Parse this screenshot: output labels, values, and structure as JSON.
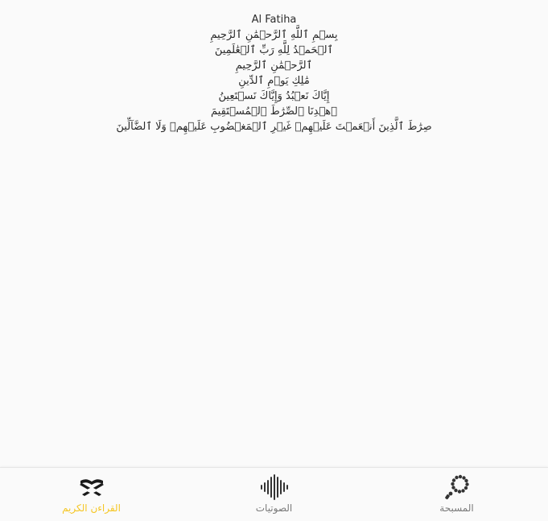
{
  "surah": {
    "title": "Al Fatiha",
    "ayahs": [
      "بِسۡمِ ٱللَّهِ ٱلرَّحۡمَٰنِ ٱلرَّحِيمِ",
      "ٱلۡحَمۡدُ لِلَّهِ رَبِّ ٱلۡعَٰلَمِينَ",
      "ٱلرَّحۡمَٰنِ ٱلرَّحِيمِ",
      "مَٰلِكِ يَوۡمِ ٱلدِّينِ",
      "إِيَّاكَ نَعۡبُدُ وَإِيَّاكَ نَسۡتَعِينُ",
      "ٱهۡدِنَا ٱلصِّرَٰطَ ٱلۡمُسۡتَقِيمَ",
      "صِرَٰطَ ٱلَّذِينَ أَنۡعَمۡتَ عَلَيۡهِمۡ غَيۡرِ ٱلۡمَغۡضُوبِ عَلَيۡهِمۡ وَلَا ٱلضَّآلِّينَ"
    ]
  },
  "bottom_nav": {
    "items": [
      {
        "label": "القراءن الكريم",
        "icon": "quran-book-icon",
        "active": true
      },
      {
        "label": "الصوتيات",
        "icon": "audio-waveform-icon",
        "active": false
      },
      {
        "label": "المسبحة",
        "icon": "prayer-beads-icon",
        "active": false
      }
    ],
    "active_color": "#f5c623",
    "inactive_color": "#7a7a7a"
  }
}
